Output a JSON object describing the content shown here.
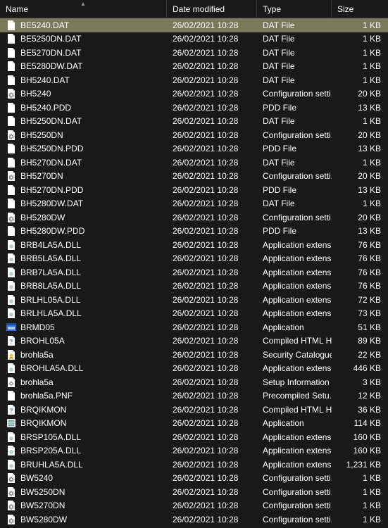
{
  "columns": {
    "name": "Name",
    "date": "Date modified",
    "type": "Type",
    "size": "Size"
  },
  "rows": [
    {
      "icon": "file",
      "name": "BE5240.DAT",
      "date": "26/02/2021 10:28",
      "type": "DAT File",
      "size": "1 KB",
      "selected": true
    },
    {
      "icon": "file",
      "name": "BE5250DN.DAT",
      "date": "26/02/2021 10:28",
      "type": "DAT File",
      "size": "1 KB"
    },
    {
      "icon": "file",
      "name": "BE5270DN.DAT",
      "date": "26/02/2021 10:28",
      "type": "DAT File",
      "size": "1 KB"
    },
    {
      "icon": "file",
      "name": "BE5280DW.DAT",
      "date": "26/02/2021 10:28",
      "type": "DAT File",
      "size": "1 KB"
    },
    {
      "icon": "file",
      "name": "BH5240.DAT",
      "date": "26/02/2021 10:28",
      "type": "DAT File",
      "size": "1 KB"
    },
    {
      "icon": "gear",
      "name": "BH5240",
      "date": "26/02/2021 10:28",
      "type": "Configuration setti...",
      "size": "20 KB"
    },
    {
      "icon": "file",
      "name": "BH5240.PDD",
      "date": "26/02/2021 10:28",
      "type": "PDD File",
      "size": "13 KB"
    },
    {
      "icon": "file",
      "name": "BH5250DN.DAT",
      "date": "26/02/2021 10:28",
      "type": "DAT File",
      "size": "1 KB"
    },
    {
      "icon": "gear",
      "name": "BH5250DN",
      "date": "26/02/2021 10:28",
      "type": "Configuration setti...",
      "size": "20 KB"
    },
    {
      "icon": "file",
      "name": "BH5250DN.PDD",
      "date": "26/02/2021 10:28",
      "type": "PDD File",
      "size": "13 KB"
    },
    {
      "icon": "file",
      "name": "BH5270DN.DAT",
      "date": "26/02/2021 10:28",
      "type": "DAT File",
      "size": "1 KB"
    },
    {
      "icon": "gear",
      "name": "BH5270DN",
      "date": "26/02/2021 10:28",
      "type": "Configuration setti...",
      "size": "20 KB"
    },
    {
      "icon": "file",
      "name": "BH5270DN.PDD",
      "date": "26/02/2021 10:28",
      "type": "PDD File",
      "size": "13 KB"
    },
    {
      "icon": "file",
      "name": "BH5280DW.DAT",
      "date": "26/02/2021 10:28",
      "type": "DAT File",
      "size": "1 KB"
    },
    {
      "icon": "gear",
      "name": "BH5280DW",
      "date": "26/02/2021 10:28",
      "type": "Configuration setti...",
      "size": "20 KB"
    },
    {
      "icon": "file",
      "name": "BH5280DW.PDD",
      "date": "26/02/2021 10:28",
      "type": "PDD File",
      "size": "13 KB"
    },
    {
      "icon": "dll",
      "name": "BRB4LA5A.DLL",
      "date": "26/02/2021 10:28",
      "type": "Application extens...",
      "size": "76 KB"
    },
    {
      "icon": "dll",
      "name": "BRB5LA5A.DLL",
      "date": "26/02/2021 10:28",
      "type": "Application extens...",
      "size": "76 KB"
    },
    {
      "icon": "dll",
      "name": "BRB7LA5A.DLL",
      "date": "26/02/2021 10:28",
      "type": "Application extens...",
      "size": "76 KB"
    },
    {
      "icon": "dll",
      "name": "BRB8LA5A.DLL",
      "date": "26/02/2021 10:28",
      "type": "Application extens...",
      "size": "76 KB"
    },
    {
      "icon": "dll",
      "name": "BRLHL05A.DLL",
      "date": "26/02/2021 10:28",
      "type": "Application extens...",
      "size": "72 KB"
    },
    {
      "icon": "dll",
      "name": "BRLHLA5A.DLL",
      "date": "26/02/2021 10:28",
      "type": "Application extens...",
      "size": "73 KB"
    },
    {
      "icon": "app",
      "name": "BRMD05",
      "date": "26/02/2021 10:28",
      "type": "Application",
      "size": "51 KB"
    },
    {
      "icon": "chm",
      "name": "BROHL05A",
      "date": "26/02/2021 10:28",
      "type": "Compiled HTML H...",
      "size": "89 KB"
    },
    {
      "icon": "cat",
      "name": "brohla5a",
      "date": "26/02/2021 10:28",
      "type": "Security Catalogue",
      "size": "22 KB"
    },
    {
      "icon": "dll",
      "name": "BROHLA5A.DLL",
      "date": "26/02/2021 10:28",
      "type": "Application extens...",
      "size": "446 KB"
    },
    {
      "icon": "inf",
      "name": "brohla5a",
      "date": "26/02/2021 10:28",
      "type": "Setup Information",
      "size": "3 KB"
    },
    {
      "icon": "file",
      "name": "brohla5a.PNF",
      "date": "26/02/2021 10:28",
      "type": "Precompiled Setu...",
      "size": "12 KB"
    },
    {
      "icon": "chm",
      "name": "BRQIKMON",
      "date": "26/02/2021 10:28",
      "type": "Compiled HTML H...",
      "size": "36 KB"
    },
    {
      "icon": "app2",
      "name": "BRQIKMON",
      "date": "26/02/2021 10:28",
      "type": "Application",
      "size": "114 KB"
    },
    {
      "icon": "dll",
      "name": "BRSP105A.DLL",
      "date": "26/02/2021 10:28",
      "type": "Application extens...",
      "size": "160 KB"
    },
    {
      "icon": "dll",
      "name": "BRSP205A.DLL",
      "date": "26/02/2021 10:28",
      "type": "Application extens...",
      "size": "160 KB"
    },
    {
      "icon": "dll",
      "name": "BRUHLA5A.DLL",
      "date": "26/02/2021 10:28",
      "type": "Application extens...",
      "size": "1,231 KB"
    },
    {
      "icon": "gear",
      "name": "BW5240",
      "date": "26/02/2021 10:28",
      "type": "Configuration setti...",
      "size": "1 KB"
    },
    {
      "icon": "gear",
      "name": "BW5250DN",
      "date": "26/02/2021 10:28",
      "type": "Configuration setti...",
      "size": "1 KB"
    },
    {
      "icon": "gear",
      "name": "BW5270DN",
      "date": "26/02/2021 10:28",
      "type": "Configuration setti...",
      "size": "1 KB"
    },
    {
      "icon": "gear",
      "name": "BW5280DW",
      "date": "26/02/2021 10:28",
      "type": "Configuration setti...",
      "size": "1 KB"
    }
  ]
}
